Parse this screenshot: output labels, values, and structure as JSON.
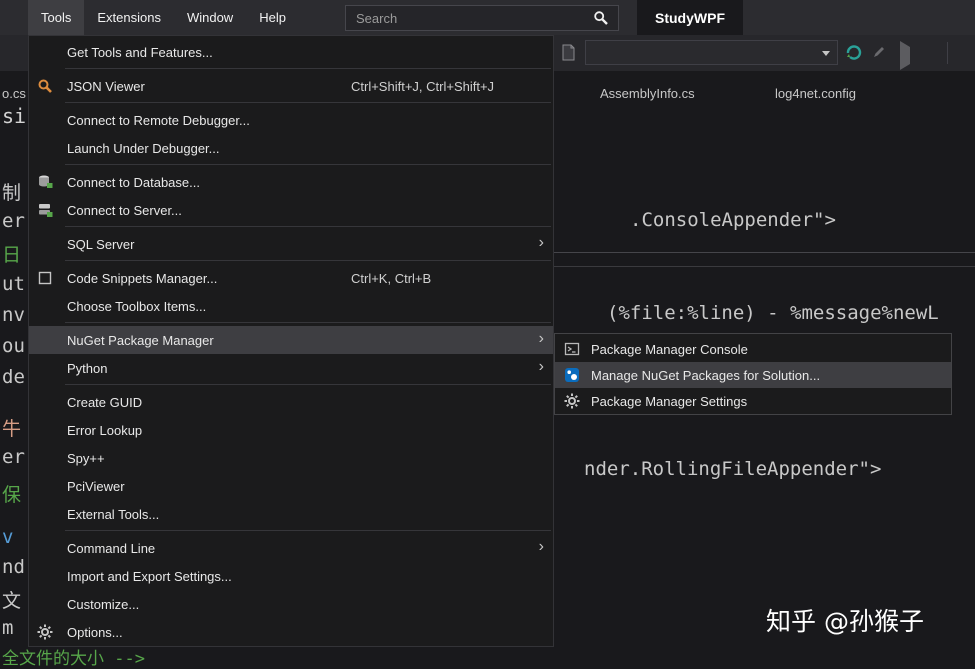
{
  "menubar": {
    "items": [
      {
        "label": "Tools"
      },
      {
        "label": "Extensions"
      },
      {
        "label": "Window"
      },
      {
        "label": "Help"
      }
    ],
    "search_placeholder": "Search",
    "app_title": "StudyWPF"
  },
  "tabs": [
    {
      "label": "AssemblyInfo.cs"
    },
    {
      "label": "log4net.config"
    }
  ],
  "tools_menu": {
    "items": [
      {
        "label": "Get Tools and Features..."
      },
      {
        "label": "JSON Viewer",
        "shortcut": "Ctrl+Shift+J, Ctrl+Shift+J"
      },
      {
        "label": "Connect to Remote Debugger..."
      },
      {
        "label": "Launch Under Debugger..."
      },
      {
        "label": "Connect to Database..."
      },
      {
        "label": "Connect to Server..."
      },
      {
        "label": "SQL Server",
        "has_submenu": true
      },
      {
        "label": "Code Snippets Manager...",
        "shortcut": "Ctrl+K, Ctrl+B"
      },
      {
        "label": "Choose Toolbox Items..."
      },
      {
        "label": "NuGet Package Manager",
        "has_submenu": true,
        "selected": true
      },
      {
        "label": "Python",
        "has_submenu": true
      },
      {
        "label": "Create GUID"
      },
      {
        "label": "Error Lookup"
      },
      {
        "label": "Spy++"
      },
      {
        "label": "PciViewer"
      },
      {
        "label": "External Tools..."
      },
      {
        "label": "Command Line",
        "has_submenu": true
      },
      {
        "label": "Import and Export Settings..."
      },
      {
        "label": "Customize..."
      },
      {
        "label": "Options..."
      }
    ]
  },
  "nuget_submenu": {
    "items": [
      {
        "label": "Package Manager Console"
      },
      {
        "label": "Manage NuGet Packages for Solution...",
        "selected": true
      },
      {
        "label": "Package Manager Settings"
      }
    ]
  },
  "editor": {
    "code_lines": [
      ".ConsoleAppender\">",
      "(%file:%line) - %message%newL",
      "nder.RollingFileAppender\">"
    ],
    "left_fragments": [
      "o.cs",
      "si",
      "制",
      "er",
      "日",
      "ut",
      "nv",
      "ou",
      "de",
      "牛",
      "er",
      "保",
      "v",
      "nd",
      "文",
      "m"
    ],
    "bottom_comment": "全文件的大小 -->"
  },
  "watermark": "知乎 @孙猴子",
  "colors": {
    "comment_green": "#57a64a",
    "string_orange": "#d69d85",
    "keyword_blue": "#569cd6",
    "menu_bg": "#1b1b1c",
    "menu_highlight": "#3e3e42"
  }
}
